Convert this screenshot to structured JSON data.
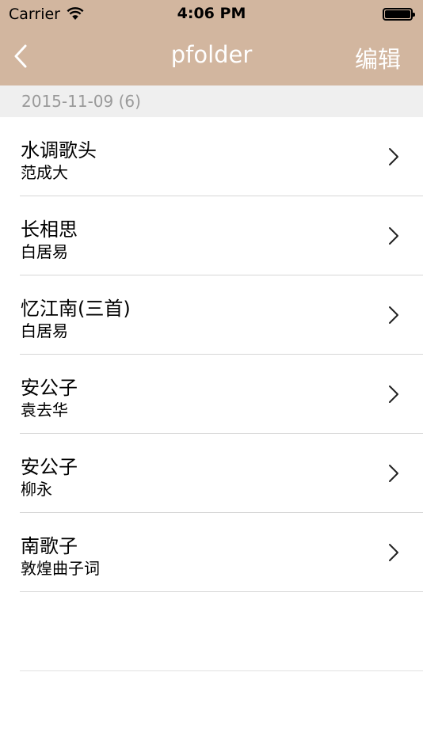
{
  "status_bar": {
    "carrier": "Carrier",
    "time": "4:06 PM"
  },
  "nav": {
    "title": "pfolder",
    "edit_label": "编辑"
  },
  "section": {
    "header": "2015-11-09 (6)"
  },
  "items": [
    {
      "title": "水调歌头",
      "author": "范成大"
    },
    {
      "title": "长相思",
      "author": "白居易"
    },
    {
      "title": "忆江南(三首)",
      "author": "白居易"
    },
    {
      "title": "安公子",
      "author": "袁去华"
    },
    {
      "title": "安公子",
      "author": "柳永"
    },
    {
      "title": "南歌子",
      "author": "敦煌曲子词"
    }
  ],
  "colors": {
    "nav_background": "#d2b69f",
    "section_background": "#efefef",
    "section_text": "#9a9a9a"
  }
}
